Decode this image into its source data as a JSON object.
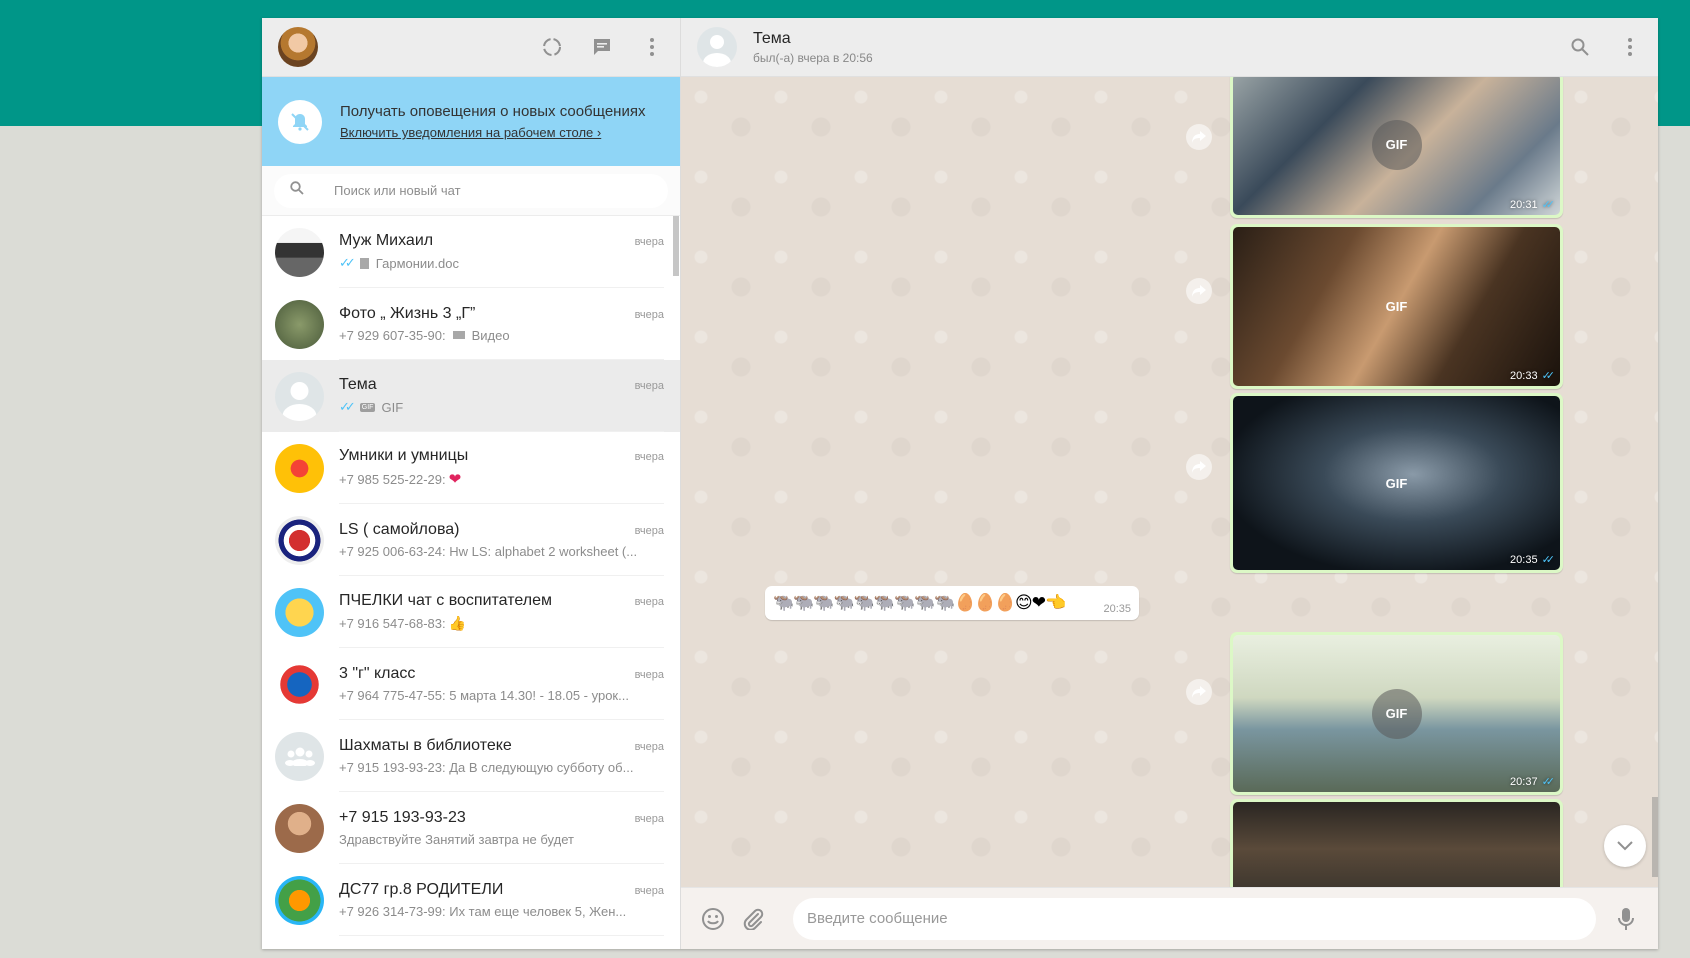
{
  "notification": {
    "title": "Получать оповещения о новых сообщениях",
    "link": "Включить уведомления на рабочем столе ›"
  },
  "search": {
    "placeholder": "Поиск или новый чат"
  },
  "chats": [
    {
      "name": "Муж Михаил",
      "time": "вчера",
      "preview": "Гармонии.doc"
    },
    {
      "name": "Фото „ Жизнь 3 „Г”",
      "time": "вчера",
      "preview_sender": "+7 929 607-35-90:",
      "preview": "Видео"
    },
    {
      "name": "Тема",
      "time": "вчера",
      "preview": "GIF",
      "badge": "GIF"
    },
    {
      "name": "Умники и умницы",
      "time": "вчера",
      "preview": "+7 985 525-22-29:",
      "emoji": "❤"
    },
    {
      "name": "LS ( самойлова)",
      "time": "вчера",
      "preview": "+7 925 006-63-24: Hw LS: alphabet 2 worksheet (..."
    },
    {
      "name": "ПЧЕЛКИ чат с воспитателем",
      "time": "вчера",
      "preview": "+7 916 547-68-83:",
      "emoji": "👍"
    },
    {
      "name": "3 \"г\" класс",
      "time": "вчера",
      "preview": "+7 964 775-47-55: 5 марта 14.30! - 18.05 - урок..."
    },
    {
      "name": "Шахматы в библиотеке",
      "time": "вчера",
      "preview": "+7 915 193-93-23: Да В следующую субботу об..."
    },
    {
      "name": "+7 915 193-93-23",
      "time": "вчера",
      "preview": "Здравствуйте Занятий завтра не будет"
    },
    {
      "name": "ДС77 гр.8 РОДИТЕЛИ",
      "time": "вчера",
      "preview": "+7 926 314-73-99: Их там еще человек 5, Жен..."
    }
  ],
  "conversation": {
    "contact_name": "Тема",
    "contact_status": "был(-а) вчера в 20:56",
    "gif_label": "GIF",
    "gif_times": [
      "20:31",
      "20:33",
      "20:35",
      "20:37"
    ],
    "text_message": {
      "emojis": "🐃🐃🐃🐃🐃🐃🐃🐃🐃🥚🥚🥚😊❤👈",
      "time": "20:35"
    }
  },
  "composer": {
    "placeholder": "Введите сообщение"
  },
  "colors": {
    "accent": "#009688",
    "outgoing": "#dcf8c6",
    "notif": "#8fd5f6",
    "tick": "#4fc3f7"
  }
}
